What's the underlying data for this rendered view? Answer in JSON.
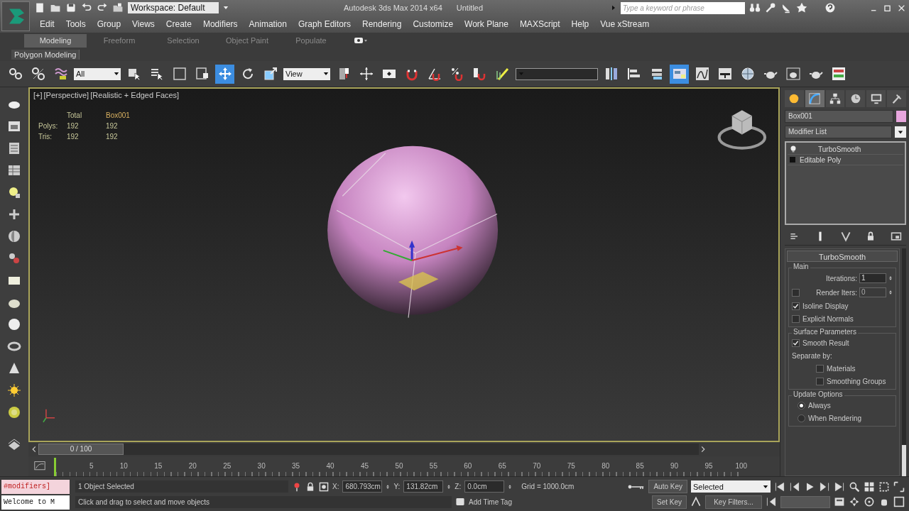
{
  "title_bar": {
    "workspace": "Workspace: Default",
    "title": "Autodesk 3ds Max 2014 x64",
    "document": "Untitled",
    "search": {
      "placeholder": "Type a keyword or phrase"
    }
  },
  "menu": [
    "Edit",
    "Tools",
    "Group",
    "Views",
    "Create",
    "Modifiers",
    "Animation",
    "Graph Editors",
    "Rendering",
    "Customize",
    "Work Plane",
    "MAXScript",
    "Help",
    "Vue xStream"
  ],
  "ribbon": {
    "tabs": [
      {
        "label": "Modeling",
        "selected": true
      },
      {
        "label": "Freeform",
        "selected": false
      },
      {
        "label": "Selection",
        "selected": false
      },
      {
        "label": "Object Paint",
        "selected": false
      },
      {
        "label": "Populate",
        "selected": false
      }
    ],
    "panel": "Polygon Modeling"
  },
  "main_toolbar": {
    "selection_filter": "All",
    "reference_coordinate": "View",
    "tools": [
      [
        {
          "selected": false
        },
        {
          "selected": false
        },
        {
          "selected": false
        }
      ],
      [
        {
          "selected": false
        },
        {
          "selected": false
        },
        {
          "selected": false
        },
        {
          "selected": false
        },
        {
          "selected": true
        },
        {
          "selected": false
        },
        {
          "selected": false
        }
      ],
      [
        {
          "selected": false
        },
        {
          "selected": false
        },
        {
          "selected": false
        },
        {
          "selected": false
        },
        {
          "selected": false
        },
        {
          "selected": false
        },
        {
          "selected": false
        },
        {
          "selected": false
        }
      ],
      [
        {
          "selected": false
        },
        {
          "selected": false
        },
        {
          "selected": false
        },
        {
          "selected": true
        },
        {
          "selected": false
        },
        {
          "selected": false
        },
        {
          "selected": false
        },
        {
          "selected": false
        },
        {
          "selected": false
        },
        {
          "selected": false
        },
        {
          "selected": false
        }
      ]
    ]
  },
  "viewport": {
    "labels": [
      "[+]",
      "[Perspective]",
      "[Realistic + Edged Faces]"
    ],
    "stats": {
      "header": [
        "Total",
        "Box001"
      ],
      "rows": [
        {
          "label": "Polys:",
          "values": [
            "192",
            "192"
          ]
        },
        {
          "label": "Tris:",
          "values": [
            "192",
            "192"
          ]
        }
      ]
    }
  },
  "command_panel": {
    "tabs": [
      {
        "selected": false
      },
      {
        "selected": true
      },
      {
        "selected": false
      },
      {
        "selected": false
      },
      {
        "selected": false
      },
      {
        "selected": false
      }
    ],
    "object": {
      "name": "Box001",
      "color": "#e8a6de"
    },
    "modifier_list": "Modifier List",
    "stack": [
      {
        "kind": "modifier",
        "label": "TurboSmooth",
        "on": true,
        "selected": false
      },
      {
        "kind": "base",
        "label": "Editable Poly",
        "selected": false
      }
    ],
    "rollout": {
      "title": "TurboSmooth",
      "groups": [
        {
          "title": "Main",
          "controls": [
            {
              "kind": "spinner",
              "label": "Iterations:",
              "value": "1"
            },
            {
              "kind": "check_spinner",
              "label": "Render Iters:",
              "checked": false,
              "value": "0"
            },
            {
              "kind": "checkbox",
              "label": "Isoline Display",
              "checked": true
            },
            {
              "kind": "checkbox",
              "label": "Explicit Normals",
              "checked": false
            }
          ]
        },
        {
          "title": "Surface Parameters",
          "controls": [
            {
              "kind": "checkbox",
              "label": "Smooth Result",
              "checked": true
            },
            {
              "kind": "caption",
              "label": "Separate by:"
            },
            {
              "kind": "checkbox",
              "label": "Materials",
              "checked": false,
              "indent": true
            },
            {
              "kind": "checkbox",
              "label": "Smoothing Groups",
              "checked": false,
              "indent": true
            }
          ]
        },
        {
          "title": "Update Options",
          "controls": [
            {
              "kind": "radio",
              "label": "Always",
              "selected": true
            },
            {
              "kind": "radio",
              "label": "When Rendering",
              "selected": false
            }
          ]
        }
      ]
    }
  },
  "time_slider": {
    "label": "0 / 100",
    "level": 0
  },
  "track_bar": {
    "ticks": [
      "5",
      "10",
      "15",
      "20",
      "25",
      "30",
      "35",
      "40",
      "45",
      "50",
      "55",
      "60",
      "65",
      "70",
      "75",
      "80",
      "85",
      "90",
      "95",
      "100"
    ]
  },
  "status_bar": {
    "listener": [
      "#modifiers]",
      "Welcome to M"
    ],
    "selection": "1 Object Selected",
    "prompt": "Click and drag to select and move objects",
    "coords": [
      {
        "axis": "X:",
        "value": "680.793cm"
      },
      {
        "axis": "Y:",
        "value": "131.82cm"
      },
      {
        "axis": "Z:",
        "value": "0.0cm"
      }
    ],
    "grid": "Grid = 1000.0cm",
    "add_time_tag": "Add Time Tag",
    "auto_key": "Auto Key",
    "set_key": "Set Key",
    "key_mode": "Selected",
    "key_filters": "Key Filters..."
  }
}
